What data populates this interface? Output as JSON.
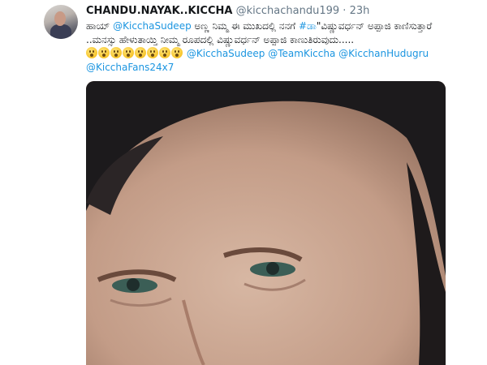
{
  "tweet": {
    "display_name": "CHANDU.NAYAK..KICCHA",
    "handle": "@kicchachandu199",
    "separator": "·",
    "time": "23h",
    "line1": {
      "pre": "ಹಾಯ್ ",
      "mention": "@KicchaSudeep",
      "mid": " ಅಣ್ಣ ನಿಮ್ಮ ಈ ಮುಖದಲ್ಲಿ ನನಗೆ ",
      "hashtag": "#ಡಾ",
      "post": "\"ವಿಷ್ಣುವರ್ಧನ್ ಅಪ್ಪಾಜಿ ಕಾಣಿಸುತ್ತಾರೆ"
    },
    "line2": "..ಮನಸ್ಸು ಹೇಳುತಾಯ್ತಿ ನೀಮ್ಮ ರೂಪದಲ್ಲಿ ವಿಷ್ಣುವರ್ಧನ್ ಅಪ್ಪಾಜಿ ಕಾಣುತಿರುವುದು.....",
    "emoji_name": "hushed-face-emoji",
    "emoji_count": 8,
    "mentions": [
      "@KicchaSudeep",
      "@TeamKiccha",
      "@KicchanHudugru",
      "@KicchaFans24x7"
    ]
  },
  "colors": {
    "link": "#1b95e0",
    "secondary_text": "#657786",
    "primary_text": "#14171a"
  }
}
